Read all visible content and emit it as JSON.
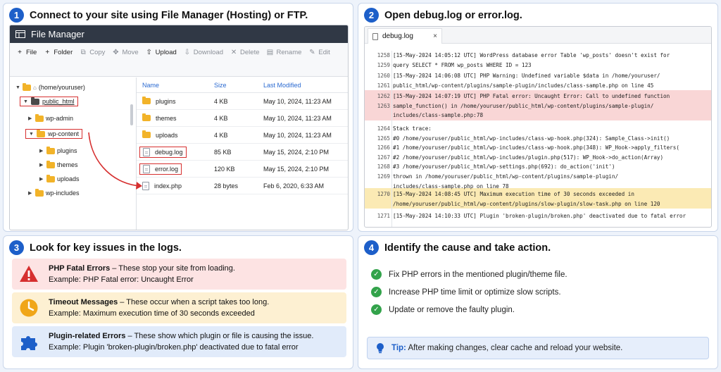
{
  "step1": {
    "number": "1",
    "title": "Connect to your site using File Manager (Hosting) or FTP.",
    "window_title": "File Manager",
    "toolbar": [
      {
        "label": "File",
        "icon": "plus-icon",
        "enabled": true
      },
      {
        "label": "Folder",
        "icon": "plus-icon",
        "enabled": true
      },
      {
        "label": "Copy",
        "icon": "copy-icon",
        "enabled": false
      },
      {
        "label": "Move",
        "icon": "move-icon",
        "enabled": false
      },
      {
        "label": "Upload",
        "icon": "upload-icon",
        "enabled": true
      },
      {
        "label": "Download",
        "icon": "download-icon",
        "enabled": false
      },
      {
        "label": "Delete",
        "icon": "delete-icon",
        "enabled": false
      },
      {
        "label": "Rename",
        "icon": "rename-icon",
        "enabled": false
      },
      {
        "label": "Edit",
        "icon": "edit-icon",
        "enabled": false
      }
    ],
    "tree": {
      "root": "(home/youruser)",
      "public_html": "public_html",
      "wp_admin": "wp-admin",
      "wp_content": "wp-content",
      "plugins": "plugins",
      "themes": "themes",
      "uploads": "uploads",
      "wp_includes": "wp-includes"
    },
    "columns": {
      "name": "Name",
      "size": "Size",
      "modified": "Last Modified"
    },
    "files": [
      {
        "name": "plugins",
        "size": "4 KB",
        "modified": "May 10, 2024, 11:23 AM",
        "type": "folder",
        "highlighted": false
      },
      {
        "name": "themes",
        "size": "4 KB",
        "modified": "May 10, 2024, 11:23 AM",
        "type": "folder",
        "highlighted": false
      },
      {
        "name": "uploads",
        "size": "4 KB",
        "modified": "May 10, 2024, 11:23 AM",
        "type": "folder",
        "highlighted": false
      },
      {
        "name": "debug.log",
        "size": "85 KB",
        "modified": "May 15, 2024, 2:10 PM",
        "type": "file",
        "highlighted": true
      },
      {
        "name": "error.log",
        "size": "120 KB",
        "modified": "May 15, 2024, 2:10 PM",
        "type": "file",
        "highlighted": true
      },
      {
        "name": "index.php",
        "size": "28 bytes",
        "modified": "Feb 6, 2020, 6:33 AM",
        "type": "file",
        "highlighted": false
      }
    ]
  },
  "step2": {
    "number": "2",
    "title": "Open debug.log or error.log.",
    "tab_label": "debug.log",
    "close_glyph": "×",
    "lines": [
      {
        "nums": [
          "1258",
          "1259"
        ],
        "text": [
          "[15-May-2024 14:05:12 UTC] WordPress database error Table 'wp_posts' doesn't exist for",
          "query SELECT * FROM wp_posts WHERE ID = 123"
        ],
        "hl": ""
      },
      {
        "nums": [
          "1260",
          "1261"
        ],
        "text": [
          "[15-May-2024 14:06:08 UTC] PHP Warning:  Undefined variable $data in /home/youruser/",
          "public_html/wp-content/plugins/sample-plugin/includes/class-sample.php on line 45"
        ],
        "hl": ""
      },
      {
        "nums": [
          "1262",
          "1263"
        ],
        "text": [
          "[15-May-2024 14:07:19 UTC] PHP Fatal error:  Uncaught Error: Call to undefined function",
          "sample_function() in /home/youruser/public_html/wp-content/plugins/sample-plugin/",
          "includes/class-sample.php:78"
        ],
        "hl": "red"
      },
      {
        "nums": [
          "1264",
          "1265",
          "1266",
          "1267",
          "1268",
          "1269"
        ],
        "text": [
          "Stack trace:",
          "#0 /home/youruser/public_html/wp-includes/class-wp-hook.php(324): Sample_Class->init()",
          "#1 /home/youruser/public_html/wp-includes/class-wp-hook.php(348): WP_Hook->apply_filters(",
          "#2 /home/youruser/public_html/wp-includes/plugin.php(517): WP_Hook->do_action(Array)",
          "#3 /home/youruser/public_html/wp-settings.php(692): do_action('init')",
          " thrown in /home/youruser/public_html/wp-content/plugins/sample-plugin/",
          "includes/class-sample.php on line 78"
        ],
        "hl": ""
      },
      {
        "nums": [
          "1270"
        ],
        "text": [
          "[15-May-2024 14:08:45 UTC] Maximum execution time of 30 seconds exceeded in",
          "/home/youruser/public_html/wp-content/plugins/slow-plugin/slow-task.php on line 120"
        ],
        "hl": "yellow"
      },
      {
        "nums": [
          "1271"
        ],
        "text": [
          "[15-May-2024 14:10:33 UTC] Plugin 'broken-plugin/broken.php' deactivated due to fatal error"
        ],
        "hl": ""
      }
    ]
  },
  "step3": {
    "number": "3",
    "title": "Look for key issues in the logs.",
    "issues": [
      {
        "title": "PHP Fatal Errors",
        "desc": " – These stop your site from loading.",
        "example": "Example: PHP Fatal error: Uncaught Error",
        "icon": "warning-icon",
        "color": "#d62f2f"
      },
      {
        "title": "Timeout Messages",
        "desc": " – These occur when a script takes too long.",
        "example": "Example: Maximum execution time of 30 seconds exceeded",
        "icon": "clock-icon",
        "color": "#f0a619"
      },
      {
        "title": "Plugin-related Errors",
        "desc": " – These show which plugin or file is causing the issue.",
        "example": "Example: Plugin 'broken-plugin/broken.php' deactivated due to fatal error",
        "icon": "puzzle-icon",
        "color": "#1d5fc9"
      }
    ]
  },
  "step4": {
    "number": "4",
    "title": "Identify the cause and take action.",
    "actions": [
      "Fix PHP errors in the mentioned plugin/theme file.",
      "Increase PHP time limit or optimize slow scripts.",
      "Update or remove the faulty plugin."
    ],
    "tip_label": "Tip:",
    "tip_text": "After making changes, clear cache and reload your website."
  },
  "colors": {
    "accent": "#1d5fc9",
    "highlight_red": "#d62f2f",
    "check_green": "#33a34b"
  }
}
